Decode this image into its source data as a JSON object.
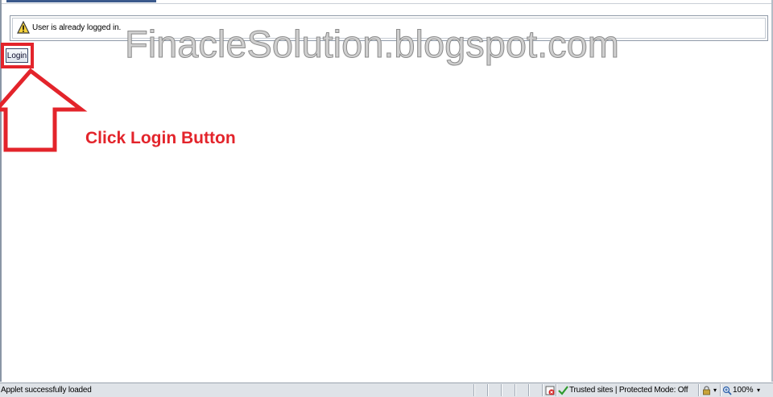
{
  "message_bar": {
    "icon": "warning-icon",
    "text": "User is already logged in."
  },
  "watermark": "FinacleSolution.blogspot.com",
  "login_button": {
    "label": "Login"
  },
  "annotation": {
    "instruction": "Click Login Button",
    "color": "#e3242b"
  },
  "status_bar": {
    "status_text": "Applet successfully loaded",
    "zone_text": "Trusted sites | Protected Mode: Off",
    "zoom_text": "100%"
  }
}
